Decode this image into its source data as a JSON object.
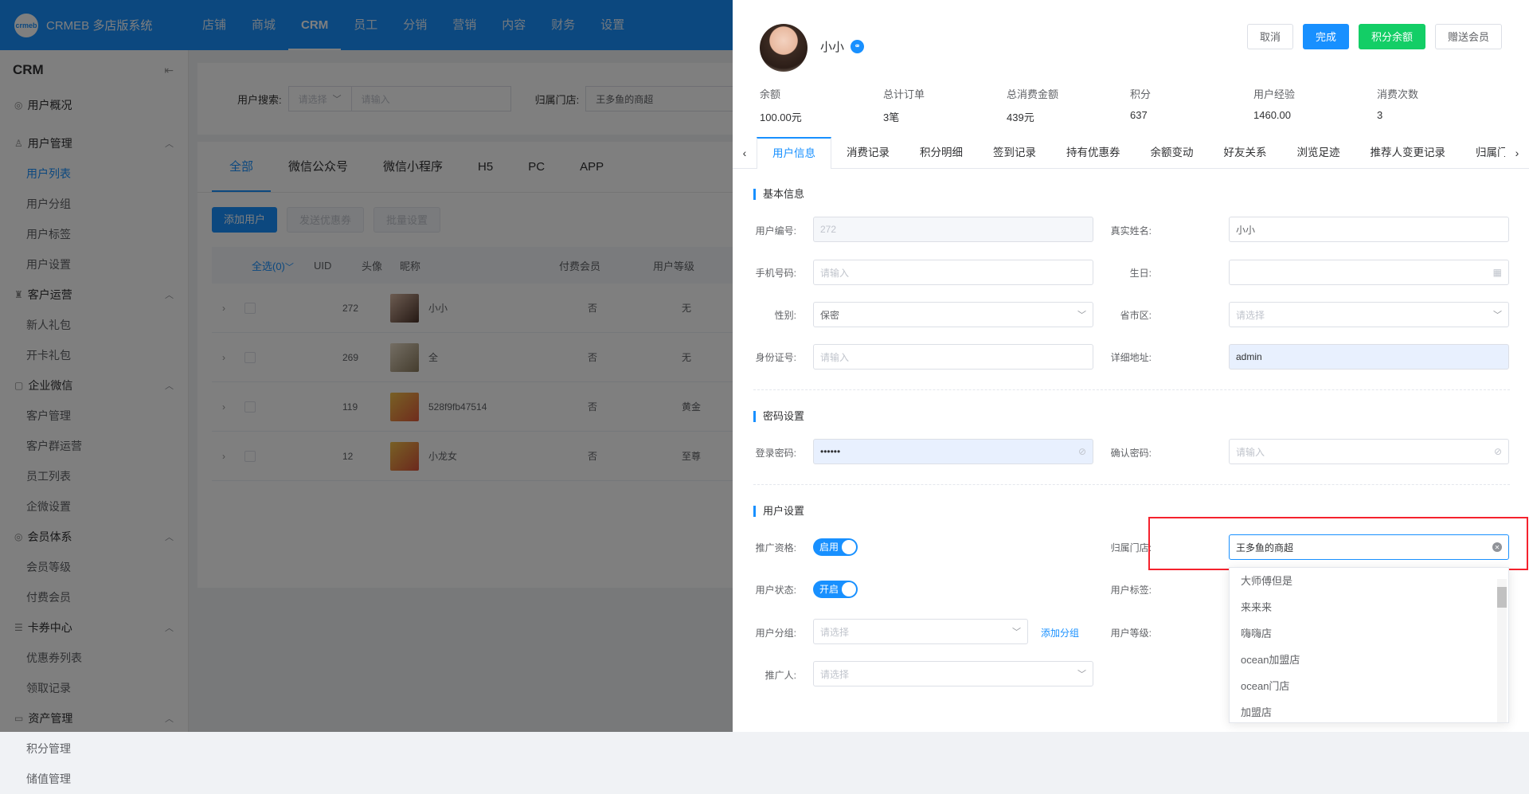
{
  "app": {
    "logo_mark": "crmeb",
    "name": "CRMEB 多店版系统"
  },
  "topnav": [
    "店铺",
    "商城",
    "CRM",
    "员工",
    "分销",
    "营销",
    "内容",
    "财务",
    "设置"
  ],
  "sidebar": {
    "title": "CRM",
    "collapse_icon": "collapse-icon",
    "groups": [
      {
        "label": "用户概况",
        "icon": "chart-icon",
        "items": []
      },
      {
        "label": "用户管理",
        "icon": "user-icon",
        "items": [
          "用户列表",
          "用户分组",
          "用户标签",
          "用户设置"
        ]
      },
      {
        "label": "客户运营",
        "icon": "gift-icon",
        "items": [
          "新人礼包",
          "开卡礼包"
        ]
      },
      {
        "label": "企业微信",
        "icon": "wechat-icon",
        "items": [
          "客户管理",
          "客户群运营",
          "员工列表",
          "企微设置"
        ]
      },
      {
        "label": "会员体系",
        "icon": "vip-icon",
        "items": [
          "会员等级",
          "付费会员"
        ]
      },
      {
        "label": "卡券中心",
        "icon": "card-icon",
        "items": [
          "优惠券列表",
          "领取记录"
        ]
      },
      {
        "label": "资产管理",
        "icon": "asset-icon",
        "items": [
          "积分管理",
          "储值管理"
        ]
      }
    ]
  },
  "filter": {
    "search_label": "用户搜索:",
    "search_select": "请选择",
    "search_input": "请输入",
    "store_label": "归属门店:",
    "store_value": "王多鱼的商超"
  },
  "list": {
    "tabs": [
      "全部",
      "微信公众号",
      "微信小程序",
      "H5",
      "PC",
      "APP"
    ],
    "buttons": [
      "添加用户",
      "发送优惠券",
      "批量设置"
    ],
    "headers": [
      "全选(0)",
      "UID",
      "头像",
      "昵称",
      "付费会员",
      "用户等级"
    ],
    "rows": [
      {
        "uid": "272",
        "nick": "小小",
        "paid": "否",
        "level": "无"
      },
      {
        "uid": "269",
        "nick": "全",
        "paid": "否",
        "level": "无"
      },
      {
        "uid": "119",
        "nick": "528f9fb47514",
        "paid": "否",
        "level": "黄金"
      },
      {
        "uid": "12",
        "nick": "小龙女",
        "paid": "否",
        "level": "至尊"
      }
    ]
  },
  "drawer": {
    "name": "小小",
    "buttons": {
      "cancel": "取消",
      "done": "完成",
      "points": "积分余额",
      "gift": "赠送会员"
    },
    "stats": [
      {
        "label": "余额",
        "value": "100.00元"
      },
      {
        "label": "总计订单",
        "value": "3笔"
      },
      {
        "label": "总消费金额",
        "value": "439元"
      },
      {
        "label": "积分",
        "value": "637"
      },
      {
        "label": "用户经验",
        "value": "1460.00"
      },
      {
        "label": "消费次数",
        "value": "3"
      }
    ],
    "tabs": [
      "用户信息",
      "消费记录",
      "积分明细",
      "签到记录",
      "持有优惠券",
      "余额变动",
      "好友关系",
      "浏览足迹",
      "推荐人变更记录",
      "归属门店变"
    ],
    "sections": {
      "basic": "基本信息",
      "password": "密码设置",
      "settings": "用户设置"
    },
    "fields": {
      "uid_label": "用户编号:",
      "uid_value": "272",
      "realname_label": "真实姓名:",
      "realname_value": "小小",
      "phone_label": "手机号码:",
      "phone_ph": "请输入",
      "birthday_label": "生日:",
      "gender_label": "性别:",
      "gender_value": "保密",
      "region_label": "省市区:",
      "region_ph": "请选择",
      "idcard_label": "身份证号:",
      "idcard_ph": "请输入",
      "address_label": "详细地址:",
      "address_value": "admin",
      "pwd_label": "登录密码:",
      "pwd_value": "••••••",
      "confirm_label": "确认密码:",
      "confirm_ph": "请输入",
      "promo_label": "推广资格:",
      "promo_switch": "启用",
      "store_label": "归属门店:",
      "store_value": "王多鱼的商超",
      "status_label": "用户状态:",
      "status_switch": "开启",
      "tag_label": "用户标签:",
      "group_label": "用户分组:",
      "group_ph": "请选择",
      "group_add": "添加分组",
      "level_label": "用户等级:",
      "referrer_label": "推广人:",
      "referrer_ph": "请选择"
    },
    "store_options": [
      "大师傅但是",
      "来来来",
      "嗨嗨店",
      "ocean加盟店",
      "ocean门店",
      "加盟店"
    ]
  }
}
